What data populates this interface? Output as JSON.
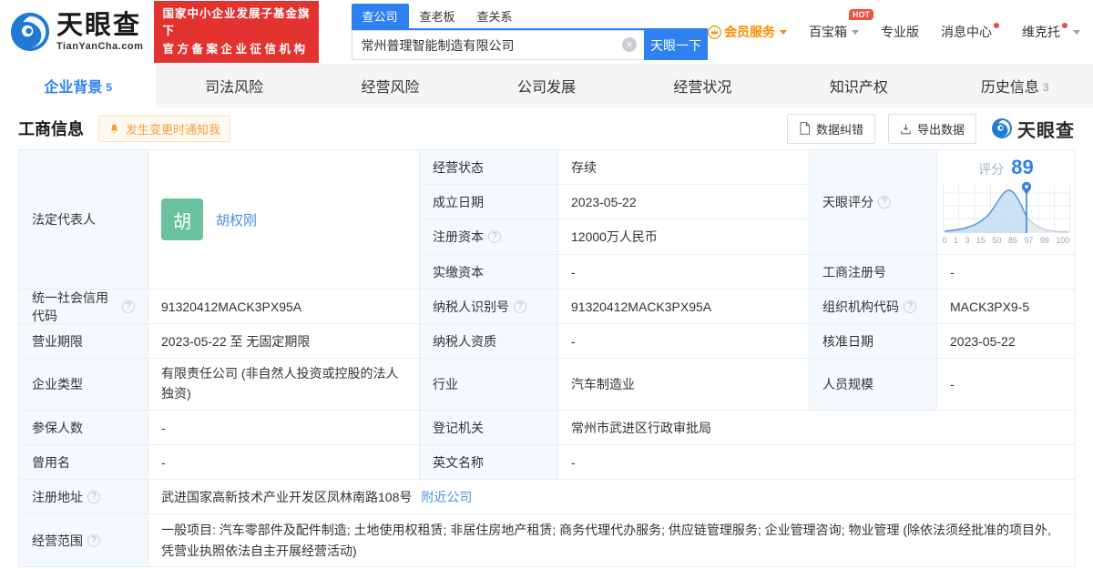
{
  "header": {
    "brand": {
      "name": "天眼查",
      "domain": "TianYanCha.com"
    },
    "badge": {
      "line1": "国家中小企业发展子基金旗下",
      "line2": "官方备案企业征信机构"
    },
    "search": {
      "tabs": [
        {
          "label": "查公司",
          "active": true
        },
        {
          "label": "查老板",
          "active": false
        },
        {
          "label": "查关系",
          "active": false
        }
      ],
      "value": "常州普理智能制造有限公司",
      "button": "天眼一下"
    },
    "menu": {
      "member": "会员服务",
      "toolbox": "百宝箱",
      "hot": "HOT",
      "pro": "专业版",
      "messages": "消息中心",
      "user": "维克托"
    }
  },
  "tabs": [
    {
      "label": "企业背景",
      "count": "5",
      "active": true
    },
    {
      "label": "司法风险"
    },
    {
      "label": "经营风险"
    },
    {
      "label": "公司发展"
    },
    {
      "label": "经营状况"
    },
    {
      "label": "知识产权"
    },
    {
      "label": "历史信息",
      "count": "3"
    }
  ],
  "section": {
    "title": "工商信息",
    "notify": "发生变更时通知我",
    "correct_btn": "数据纠错",
    "export_btn": "导出数据",
    "watermark": "天眼查"
  },
  "info": {
    "legal_rep_label": "法定代表人",
    "legal_rep_avatar": "胡",
    "legal_rep_name": "胡权刚",
    "status_label": "经营状态",
    "status": "存续",
    "established_label": "成立日期",
    "established": "2023-05-22",
    "reg_capital_label": "注册资本",
    "reg_capital": "12000万人民币",
    "paid_capital_label": "实缴资本",
    "paid_capital": "-",
    "score_label": "天眼评分",
    "reg_no_label": "工商注册号",
    "reg_no": "-",
    "uscc_label": "统一社会信用代码",
    "uscc": "91320412MACK3PX95A",
    "taxpayer_id_label": "纳税人识别号",
    "taxpayer_id": "91320412MACK3PX95A",
    "org_code_label": "组织机构代码",
    "org_code": "MACK3PX9-5",
    "term_label": "营业期限",
    "term": "2023-05-22 至 无固定期限",
    "taxpayer_qual_label": "纳税人资质",
    "taxpayer_qual": "-",
    "approval_label": "核准日期",
    "approval": "2023-05-22",
    "type_label": "企业类型",
    "type": "有限责任公司 (非自然人投资或控股的法人独资)",
    "industry_label": "行业",
    "industry": "汽车制造业",
    "staff_label": "人员规模",
    "staff": "-",
    "insured_label": "参保人数",
    "insured": "-",
    "authority_label": "登记机关",
    "authority": "常州市武进区行政审批局",
    "former_name_label": "曾用名",
    "former_name": "-",
    "en_name_label": "英文名称",
    "en_name": "-",
    "address_label": "注册地址",
    "address": "武进国家高新技术产业开发区凤林南路108号",
    "nearby_link": "附近公司",
    "scope_label": "经营范围",
    "scope": "一般项目: 汽车零部件及配件制造; 土地使用权租赁; 非居住房地产租赁; 商务代理代办服务; 供应链管理服务; 企业管理咨询; 物业管理 (除依法须经批准的项目外, 凭营业执照依法自主开展经营活动)"
  },
  "score_chart": {
    "type": "area",
    "title": "评分",
    "score": "89",
    "ticks": [
      "0",
      "1",
      "3",
      "15",
      "50",
      "85",
      "97",
      "99",
      "100"
    ]
  },
  "colors": {
    "primary_blue": "#2f81f2",
    "link_blue": "#4a90e2",
    "badge_red": "#e23330",
    "member_orange": "#ff8a00",
    "avatar_green": "#69c19e",
    "label_cell_bg": "#f3f9fd"
  }
}
